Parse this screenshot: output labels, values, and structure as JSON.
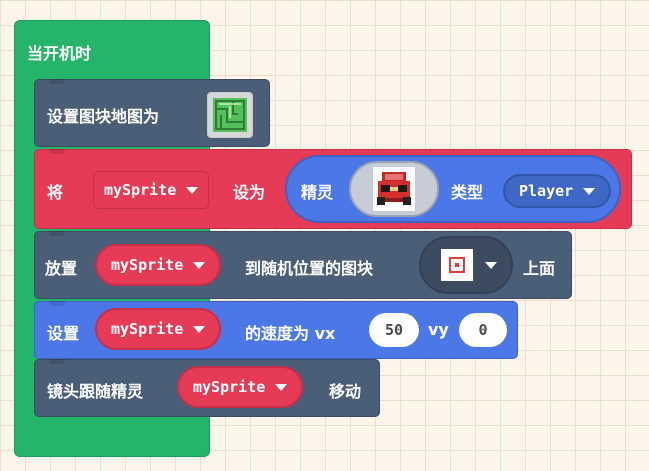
{
  "hat": {
    "label": "当开机时"
  },
  "set_tilemap": {
    "label": "设置图块地图为",
    "thumbnail_icon": "tilemap-thumbnail-icon"
  },
  "create_sprite": {
    "label_prefix": "将",
    "variable": "mySprite",
    "label_set": "设为",
    "label_sprite": "精灵",
    "sprite_icon": "red-car-sprite-icon",
    "label_type": "类型",
    "kind": "Player"
  },
  "place_sprite": {
    "label_prefix": "放置",
    "variable": "mySprite",
    "label_mid": "到随机位置的图块",
    "tile_icon": "target-tile-icon",
    "label_suffix": "上面"
  },
  "set_velocity": {
    "label_prefix": "设置",
    "variable": "mySprite",
    "label_mid": "的速度为 vx",
    "vx": "50",
    "label_vy": "vy",
    "vy": "0"
  },
  "camera_follow": {
    "label_prefix": "镜头跟随精灵",
    "variable": "mySprite",
    "label_suffix": "移动"
  },
  "colors": {
    "hat_green": "#24b56b",
    "scene_slate": "#4b5e78",
    "sprites_red": "#e63b57",
    "sprites_blue": "#4b78e6",
    "workspace_bg": "#fdf5ea"
  }
}
